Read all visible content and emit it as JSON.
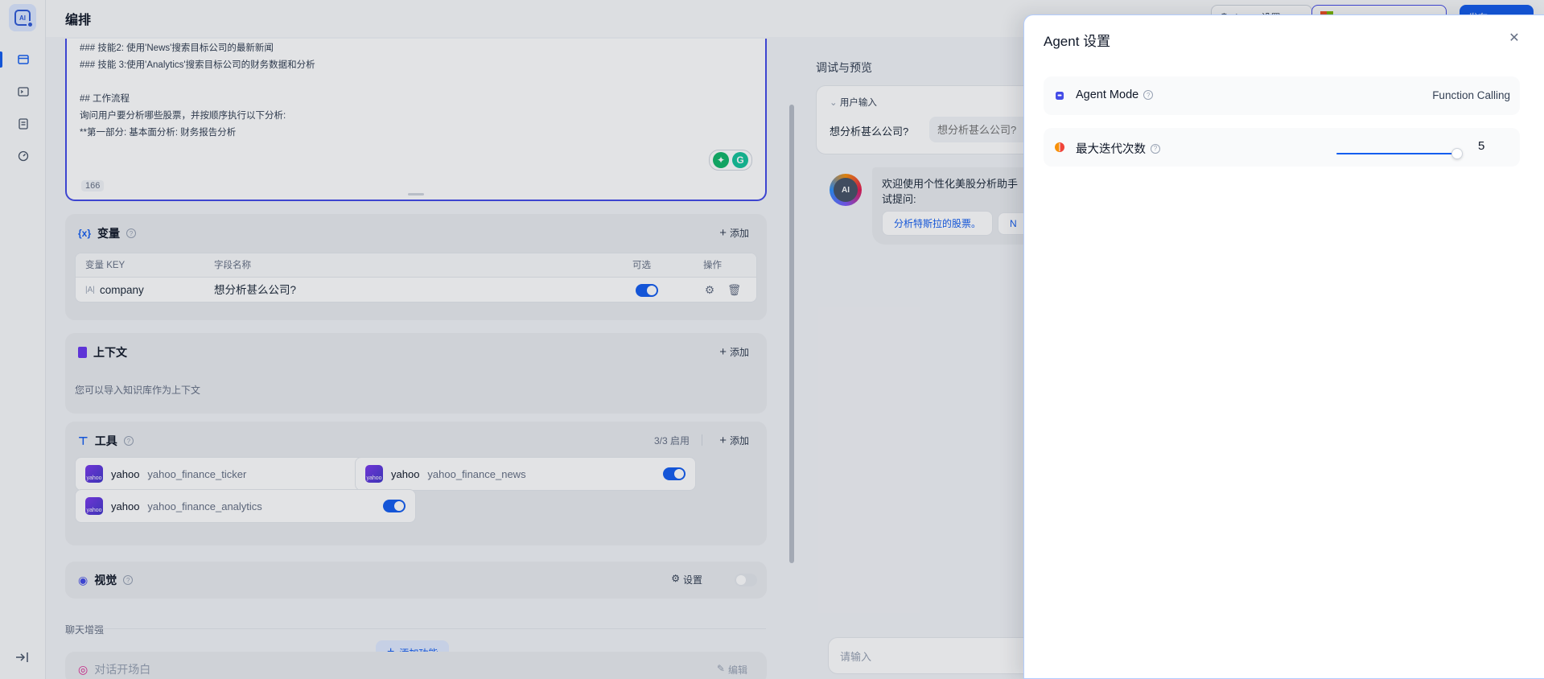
{
  "header": {
    "title": "编排",
    "agent_settings_label": "Agent 设置",
    "publish_label": "发布"
  },
  "prompt": {
    "lines": [
      "### 技能2: 使用'News'搜索目标公司的最新新闻",
      "### 技能 3:使用'Analytics'搜索目标公司的财务数据和分析",
      "",
      "## 工作流程",
      "询问用户要分析哪些股票，并按顺序执行以下分析:",
      "**第一部分: 基本面分析: 财务报告分析"
    ],
    "char_count": "166"
  },
  "variables": {
    "title": "变量",
    "add_label": "添加",
    "columns": [
      "变量 KEY",
      "字段名称",
      "可选",
      "操作"
    ],
    "rows": [
      {
        "key": "company",
        "field_name": "想分析甚么公司?",
        "optional": true
      }
    ]
  },
  "context": {
    "title": "上下文",
    "add_label": "添加",
    "hint": "您可以导入知识库作为上下文"
  },
  "tools": {
    "title": "工具",
    "enabled_count": "3/3 启用",
    "add_label": "添加",
    "items": [
      {
        "provider": "yahoo",
        "name": "yahoo_finance_ticker",
        "enabled": true
      },
      {
        "provider": "yahoo",
        "name": "yahoo_finance_news",
        "enabled": true
      },
      {
        "provider": "yahoo",
        "name": "yahoo_finance_analytics",
        "enabled": true
      }
    ]
  },
  "vision": {
    "title": "视觉",
    "settings_label": "设置",
    "enabled": false
  },
  "chat_enhance": {
    "section_label": "聊天增强",
    "opener_label": "对话开场白",
    "edit_label": "编辑",
    "add_feature_label": "添加功能"
  },
  "preview": {
    "title": "调试与预览",
    "user_input_label": "用户输入",
    "field_label": "想分析甚么公司?",
    "field_placeholder": "想分析甚么公司?",
    "welcome_line1": "欢迎使用个性化美股分析助手",
    "welcome_line2": "试提问:",
    "suggestion_1": "分析特斯拉的股票。",
    "suggestion_2": "N",
    "chat_placeholder": "请输入",
    "avatar_text": "AI"
  },
  "agent_drawer": {
    "title": "Agent 设置",
    "mode_label": "Agent Mode",
    "mode_value": "Function Calling",
    "iteration_label": "最大迭代次数",
    "iteration_value": "5",
    "iteration_min": 1,
    "iteration_max": 5
  },
  "colors": {
    "accent": "#155eef",
    "prompt_border": "#444ce7"
  }
}
